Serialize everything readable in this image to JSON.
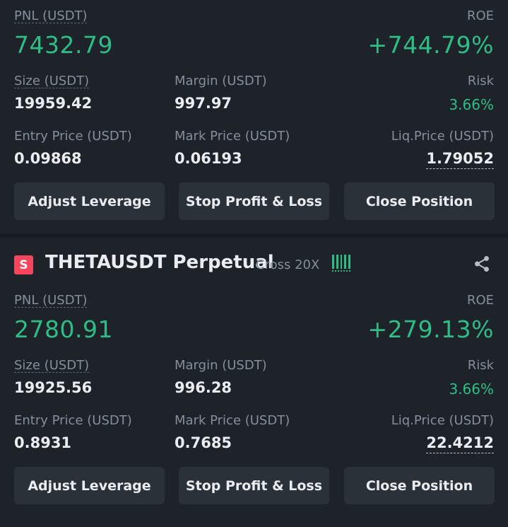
{
  "positions": [
    {
      "pnl_label": "PNL (USDT)",
      "pnl": "7432.79",
      "roe_label": "ROE",
      "roe": "+744.79%",
      "size_label": "Size (USDT)",
      "size": "19959.42",
      "margin_label": "Margin (USDT)",
      "margin": "997.97",
      "risk_label": "Risk",
      "risk": "3.66%",
      "entry_label": "Entry Price (USDT)",
      "entry": "0.09868",
      "mark_label": "Mark Price (USDT)",
      "mark": "0.06193",
      "liq_label": "Liq.Price (USDT)",
      "liq": "1.79052",
      "buttons": [
        "Adjust Leverage",
        "Stop Profit & Loss",
        "Close Position"
      ]
    },
    {
      "side_badge": "S",
      "symbol": "THETAUSDT Perpetual",
      "margin_mode": "Cross 20X",
      "pnl_label": "PNL (USDT)",
      "pnl": "2780.91",
      "roe_label": "ROE",
      "roe": "+279.13%",
      "size_label": "Size (USDT)",
      "size": "19925.56",
      "margin_label": "Margin (USDT)",
      "margin": "996.28",
      "risk_label": "Risk",
      "risk": "3.66%",
      "entry_label": "Entry Price (USDT)",
      "entry": "0.8931",
      "mark_label": "Mark Price (USDT)",
      "mark": "0.7685",
      "liq_label": "Liq.Price (USDT)",
      "liq": "22.4212",
      "buttons": [
        "Adjust Leverage",
        "Stop Profit & Loss",
        "Close Position"
      ]
    }
  ],
  "colors": {
    "background": "#1e2329",
    "button": "#2b3139",
    "profit_green": "#2ebd85",
    "short_red": "#f6465d",
    "label_gray": "#848e9c"
  },
  "icons": {
    "leverage": "signal-bars-icon",
    "share": "share-icon"
  }
}
